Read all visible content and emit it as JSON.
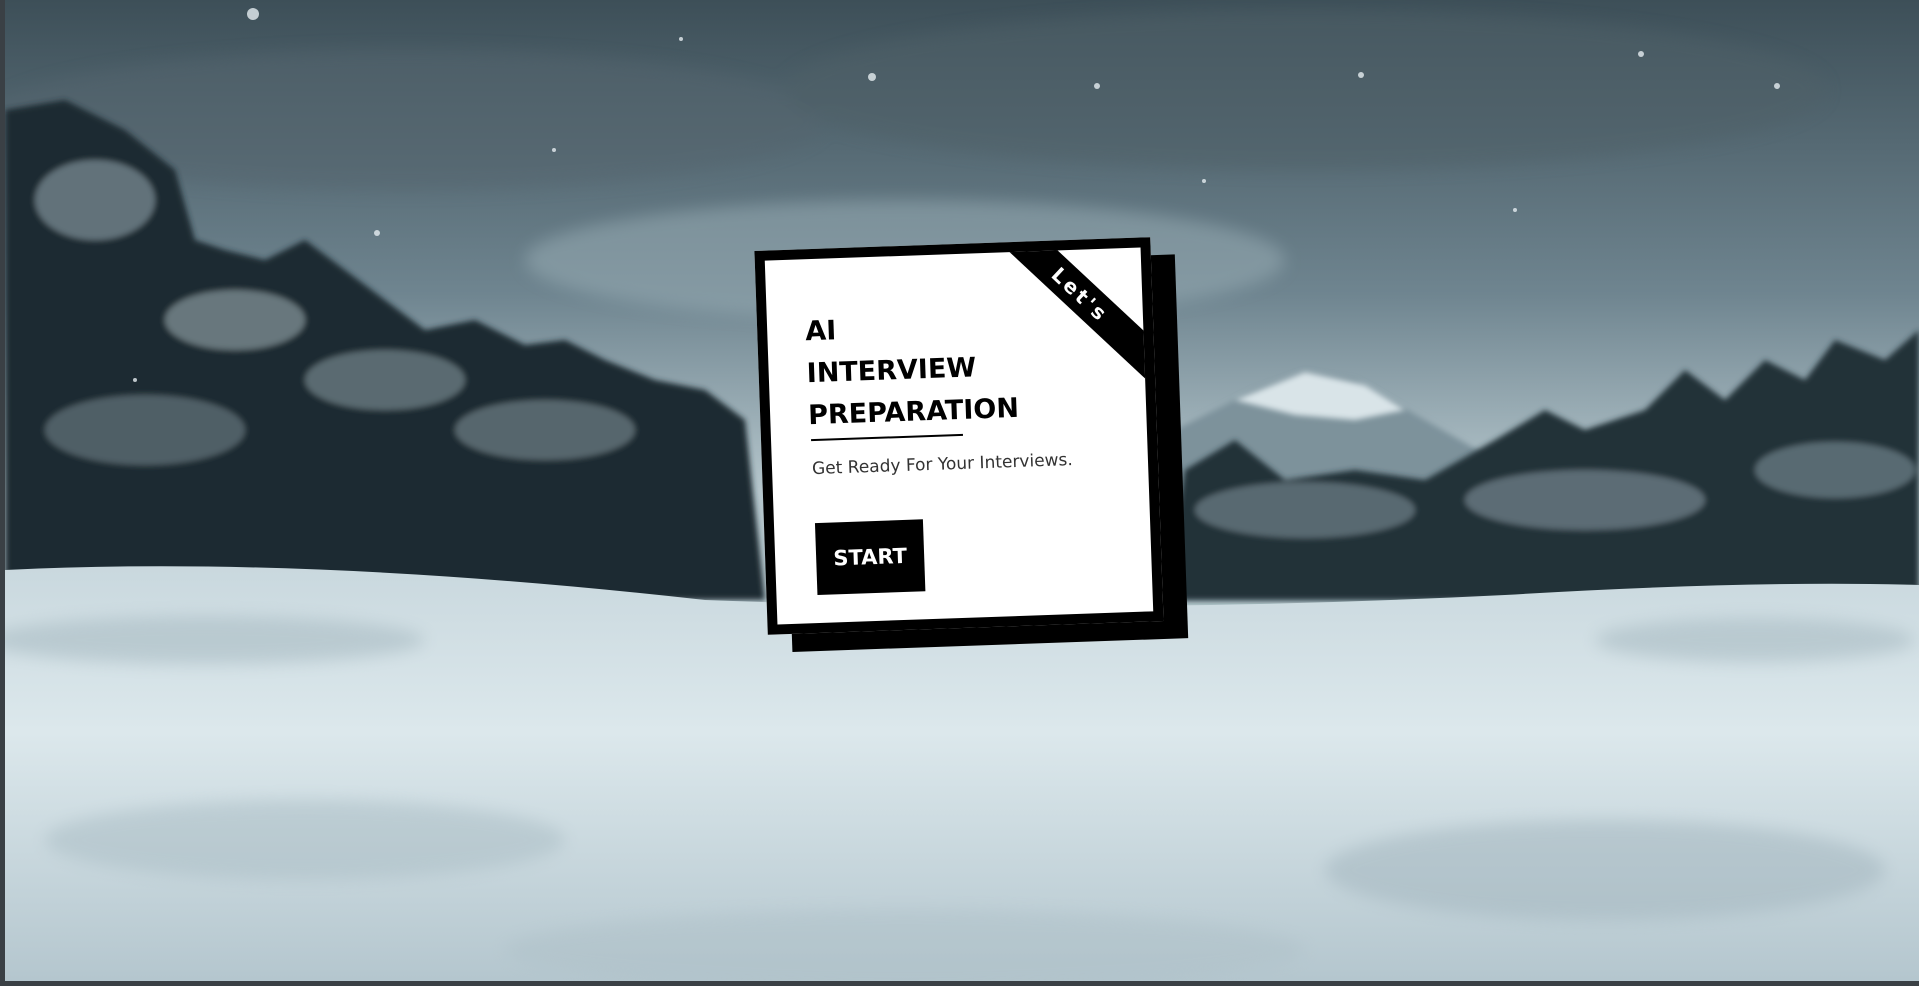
{
  "card": {
    "ribbon": "Let's",
    "title_lines": [
      "AI",
      "INTERVIEW",
      "PREPARATION"
    ],
    "subtitle": "Get Ready For Your Interviews.",
    "start_label": "START"
  },
  "theme": {
    "card_background": "#ffffff",
    "card_border": "#000000",
    "button_background": "#000000",
    "button_text": "#ffffff"
  }
}
